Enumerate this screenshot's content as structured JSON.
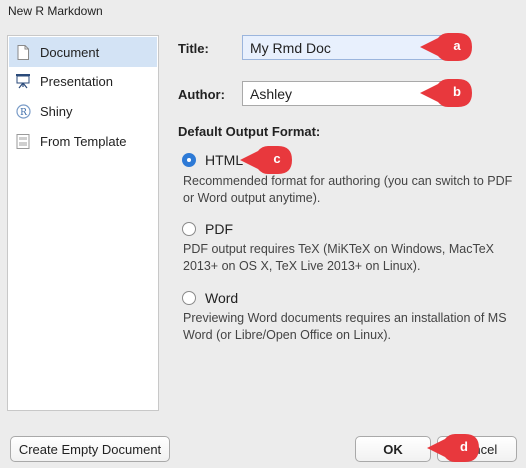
{
  "window": {
    "title": "New R Markdown"
  },
  "sidebar": {
    "items": [
      {
        "label": "Document",
        "icon": "document-icon",
        "selected": true
      },
      {
        "label": "Presentation",
        "icon": "presentation-icon",
        "selected": false
      },
      {
        "label": "Shiny",
        "icon": "shiny-icon",
        "selected": false
      },
      {
        "label": "From Template",
        "icon": "template-icon",
        "selected": false
      }
    ]
  },
  "form": {
    "title_label": "Title:",
    "title_value": "My Rmd Doc",
    "author_label": "Author:",
    "author_value": "Ashley",
    "output_heading": "Default Output Format:"
  },
  "formats": [
    {
      "label": "HTML",
      "checked": true,
      "description": "Recommended format for authoring (you can switch to PDF or Word output anytime)."
    },
    {
      "label": "PDF",
      "checked": false,
      "description": "PDF output requires TeX (MiKTeX on Windows, MacTeX 2013+ on OS X, TeX Live 2013+ on Linux)."
    },
    {
      "label": "Word",
      "checked": false,
      "description": "Previewing Word documents requires an installation of MS Word (or Libre/Open Office on Linux)."
    }
  ],
  "buttons": {
    "create_empty": "Create Empty Document",
    "ok": "OK",
    "cancel": "Cancel"
  },
  "annotations": [
    {
      "letter": "a"
    },
    {
      "letter": "b"
    },
    {
      "letter": "c"
    },
    {
      "letter": "d"
    }
  ],
  "colors": {
    "annotation_marker": "#e8383d",
    "selected_item": "#d3e3f5",
    "radio_checked": "#2e7ad6",
    "focused_input": "#e8f0fd"
  }
}
